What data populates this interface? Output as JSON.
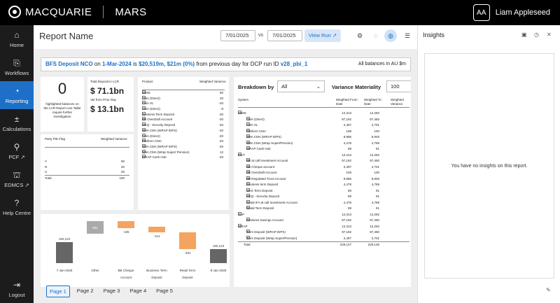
{
  "app": {
    "brand": "MACQUARIE",
    "product": "MARS",
    "user_initials": "AA",
    "user_name": "Liam Appleseed"
  },
  "nav": [
    {
      "label": "Home",
      "icon": "⌂"
    },
    {
      "label": "Workflows",
      "icon": "⎘"
    },
    {
      "label": "Reporting",
      "icon": "◔"
    },
    {
      "label": "Calculations",
      "icon": "±"
    },
    {
      "label": "PCF ↗",
      "icon": "⚲"
    },
    {
      "label": "EDMCS ↗",
      "icon": "⛫"
    },
    {
      "label": "Help Centre",
      "icon": "?"
    },
    {
      "label": "Logout",
      "icon": "⇥"
    }
  ],
  "header": {
    "title": "Report Name",
    "date_from": "7/01/2025",
    "vs": "vs",
    "date_to": "7/01/2025",
    "view_run": "View Run ↗"
  },
  "banner": {
    "metric": "BFS Deposit NCO",
    "on": "on",
    "date": "1-Mar-2024",
    "is": "is",
    "value1": "$20,519m,",
    "value2": "$21m",
    "pct": "(0%)",
    "text": "from previous day for DCP run ID",
    "run_id": "v28_pbi_1",
    "note": "All balances in AU $m"
  },
  "kpi": {
    "count": "0",
    "count_desc": "highlighted balances on the LCR Report Line Table require further investigation",
    "total_label": "Total Deposit in LCR",
    "total_value": "$ 71.1bn",
    "var_label": "Var from Prior Day",
    "var_value": "$ 13.1bn"
  },
  "product_table": {
    "headers": [
      "Product",
      "Weighted Variance"
    ],
    "rows": [
      [
        "MIMS",
        "80"
      ],
      [
        "CMA (Direct)",
        "20"
      ],
      [
        "CMA XL",
        "-20"
      ],
      [
        "CMA (Direct)",
        "-8"
      ],
      [
        "Business Term Deposit",
        "-20"
      ],
      [
        "BB Overdraft Account",
        "-20"
      ],
      [
        "MEQ - Security Deposit",
        "-20"
      ],
      [
        "SMA CMA (WRAP IDPS)",
        "-20"
      ],
      [
        "CMA (Direct)",
        "-20"
      ],
      [
        "Platform CMA",
        "-20"
      ],
      [
        "SMA CMA (WRAP IDPS)",
        "-20"
      ],
      [
        "SMA CMA (Wrap Super/ Pension)",
        "12"
      ],
      [
        "WRAP Cash Hub",
        "-20"
      ]
    ]
  },
  "pie_table": {
    "headers": [
      "Party PIE Flag",
      "Weighted Variance"
    ],
    "rows": [
      [
        "Y",
        "80"
      ],
      [
        "N",
        "20"
      ],
      [
        "U",
        "20"
      ],
      [
        "Total",
        "100"
      ]
    ]
  },
  "waterfall": {
    "bars": [
      {
        "label": "7-Jan-2025",
        "value": "150,123"
      },
      {
        "label": "Other",
        "value": "964"
      },
      {
        "label": "BB Cheque Account",
        "value": "-105"
      },
      {
        "label": "Business Term Deposit",
        "value": "-114"
      },
      {
        "label": "Retail Term Deposit",
        "value": "-281"
      },
      {
        "label": "8-Jan-2025",
        "value": "150,123"
      }
    ]
  },
  "breakdown": {
    "label": "Breakdown by",
    "select": "All",
    "materiality_label": "Variance Materiality",
    "materiality": "100",
    "headers": [
      "System",
      "Weighted From Date",
      "Weighted To Date",
      "Weighted Variance"
    ],
    "rows": [
      [
        "MIMS",
        "12,313",
        "12,292",
        0
      ],
      [
        "CMA (Direct)",
        "97,192",
        "97,450",
        1
      ],
      [
        "CMA XL",
        "2,497",
        "2,701",
        1
      ],
      [
        "Platform CMA",
        "109",
        "100",
        1
      ],
      [
        "SMA CMA (WRAP IDPS)",
        "9,986",
        "9,946",
        1
      ],
      [
        "SMA CMA (Wrap Super/Pension)",
        "4,478",
        "4,789",
        1
      ],
      [
        "WRAP Cash Hub",
        "89",
        "91",
        1
      ],
      [
        "PIVT",
        "12,313",
        "12,292",
        0
      ],
      [
        "BB at call Investment Account",
        "97,192",
        "97,450",
        1
      ],
      [
        "BB Cheque account",
        "2,497",
        "2,701",
        1
      ],
      [
        "BB Overdraft Account",
        "109",
        "100",
        1
      ],
      [
        "BB Regulated Trust Account",
        "9,986",
        "9,946",
        1
      ],
      [
        "Business term Deposit",
        "4,478",
        "4,789",
        1
      ],
      [
        "MAS Term Deposit",
        "89",
        "91",
        1
      ],
      [
        "MEQ - Security Deposit",
        "89",
        "91",
        1
      ],
      [
        "Retail IFA at call Investment Account",
        "4,478",
        "4,789",
        1
      ],
      [
        "Retail Term Deposit",
        "89",
        "91",
        1
      ],
      [
        "SAP",
        "12,313",
        "12,292",
        0
      ],
      [
        "Business Savings Account",
        "97,192",
        "97,450",
        1
      ],
      [
        "WRAP",
        "12,313",
        "12,292",
        0
      ],
      [
        "Term Deposit (WRAP IDPS)",
        "97,192",
        "97,450",
        1
      ],
      [
        "Term Deposit (Wrap Super/Pension)",
        "2,497",
        "2,701",
        1
      ],
      [
        "Total",
        "229,147",
        "229,146",
        2
      ]
    ]
  },
  "pages": [
    "Page 1",
    "Page 2",
    "Page 3",
    "Page 4",
    "Page 5"
  ],
  "insights": {
    "title": "Insights",
    "empty": "You have no insights on this report."
  }
}
